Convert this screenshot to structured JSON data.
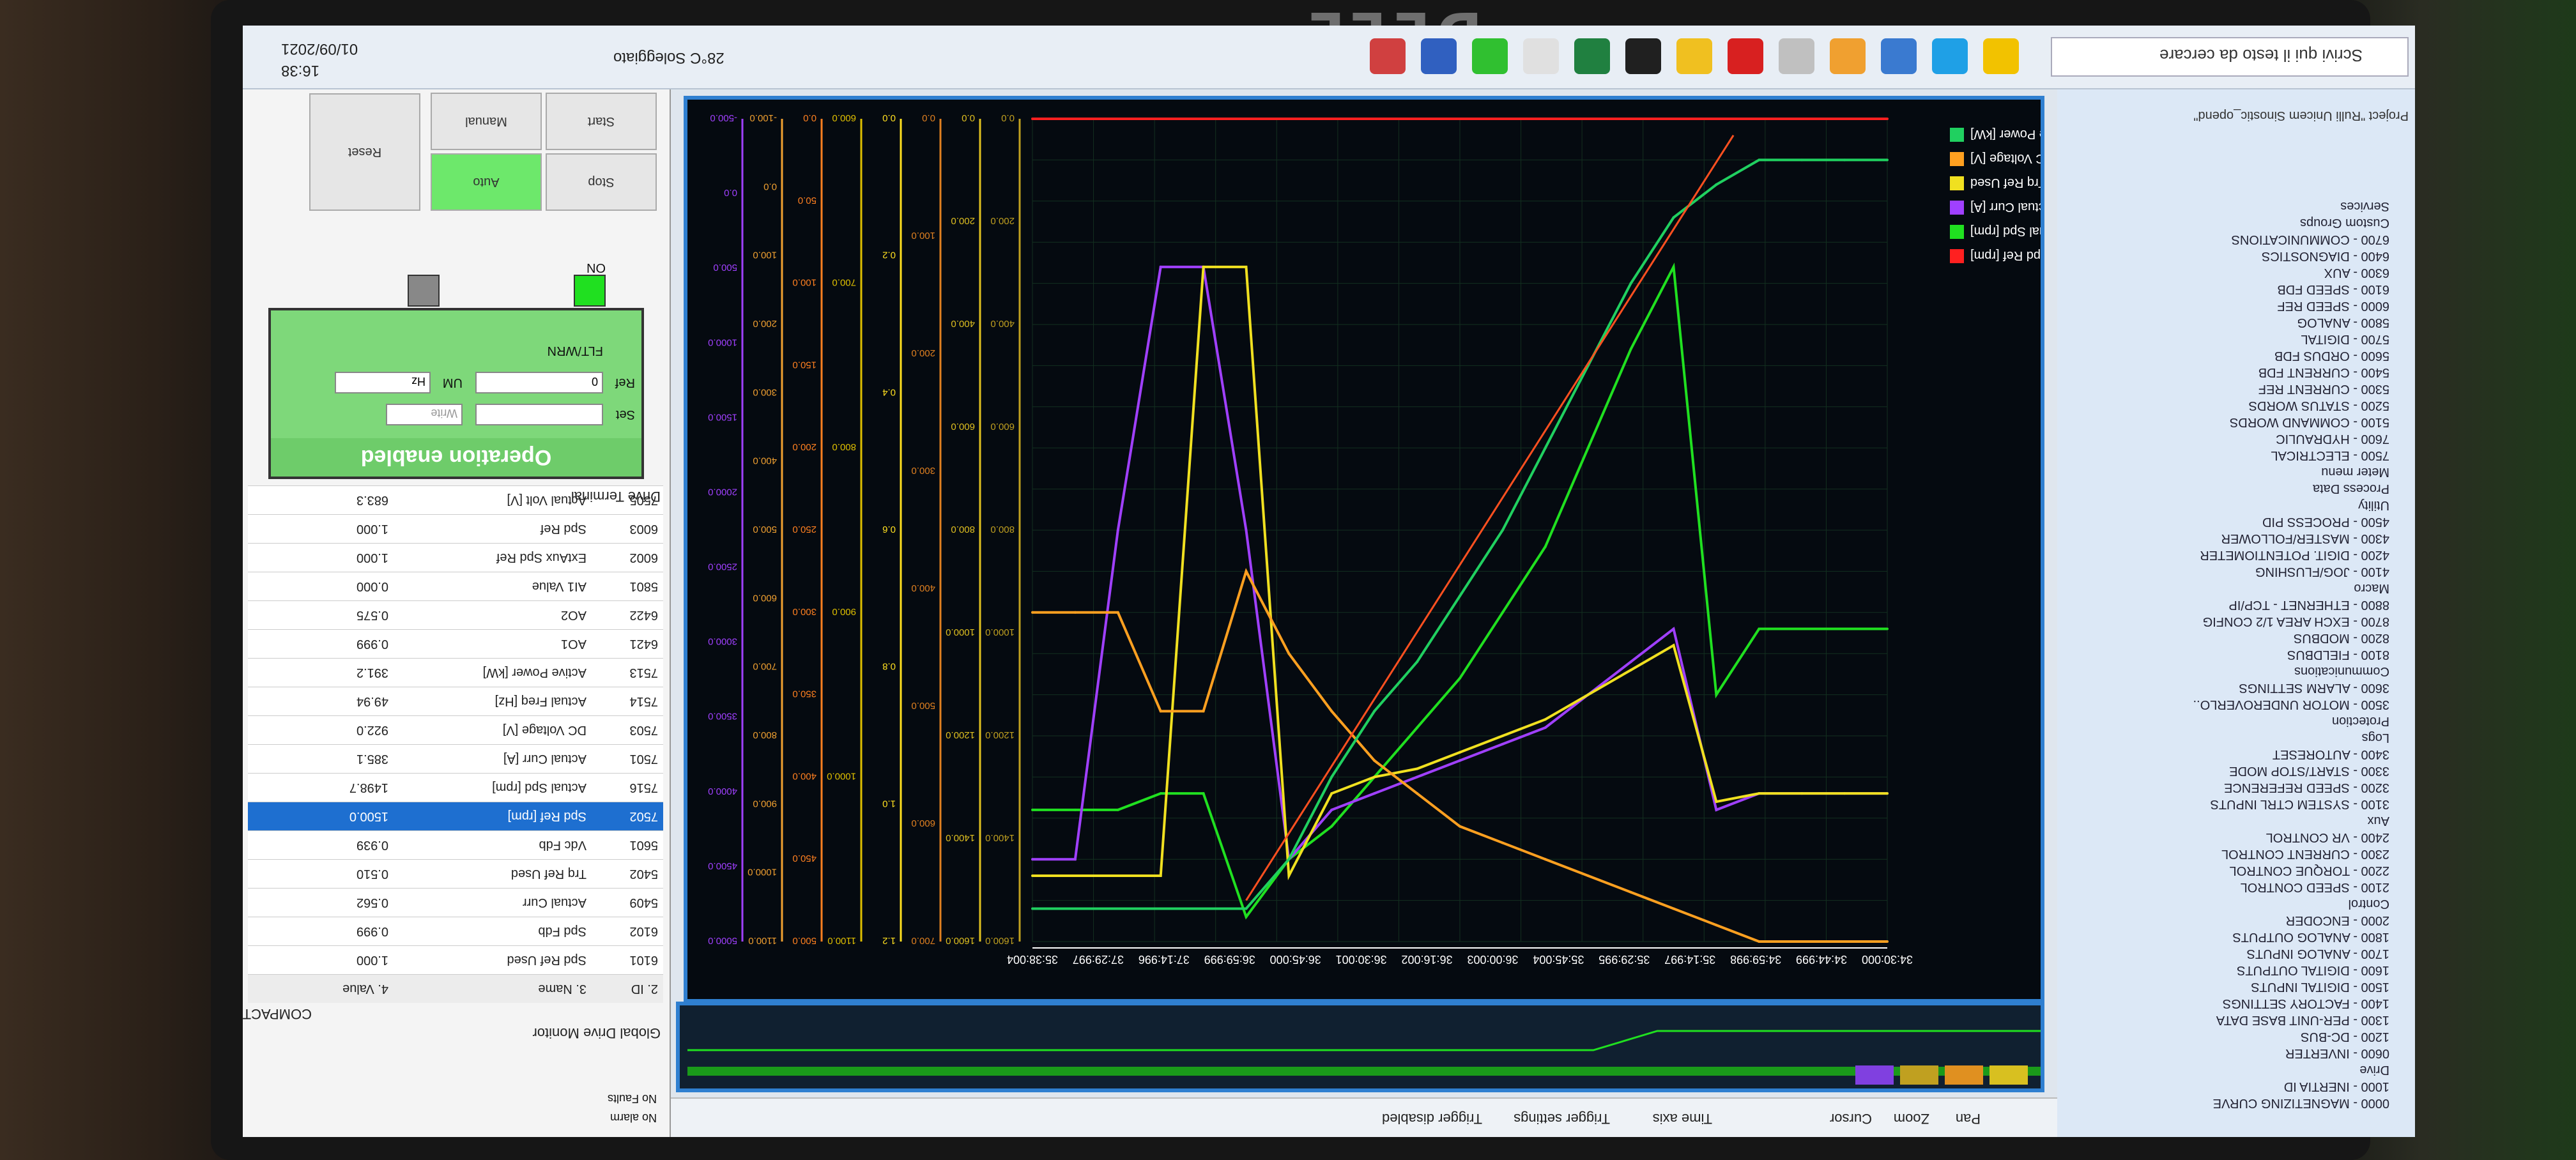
{
  "bezel_brand": "DELL",
  "taskbar": {
    "search_placeholder": "Scrivi qui il testo da cercare",
    "weather": "28°C Soleggiato",
    "time": "16:38",
    "date": "01/09/2021"
  },
  "project": {
    "title": "Project \"Rulli Unicem Sinostic_opend\"",
    "tree": [
      "0000 - MAGNETIZING CURVE",
      "1000 - INERTIA ID",
      "Drive",
      "0600 - INVERTER",
      "1200 - DC-BUS",
      "1300 - PER-UNIT BASE DATA",
      "1400 - FACTORY SETTINGS",
      "1500 - DIGITAL INPUTS",
      "1600 - DIGITAL OUTPUTS",
      "1700 - ANALOG INPUTS",
      "1800 - ANALOG OUTPUTS",
      "2000 - ENCODER",
      "Control",
      "2100 - SPEED CONTROL",
      "2200 - TORQUE CONTROL",
      "2300 - CURRENT CONTROL",
      "2400 - VR CONTROL",
      "Aux",
      "3100 - SYSTEM CTRL INPUTS",
      "3200 - SPEED REFERENCE",
      "3300 - START/STOP MODE",
      "3400 - AUTORESET",
      "Logs",
      "Protection",
      "3500 - MOTOR UNDEROVERLO..",
      "3600 - ALARM SETTINGS",
      "Communications",
      "8100 - FIELDBUS",
      "8200 - MODBUS",
      "8700 - EXCH AREA 1/2 CONFIG",
      "8800 - ETHERNET - TCP/IP",
      "Macro",
      "4100 - JOG/FLUSHING",
      "4200 - DIGIT. POTENTIOMETER",
      "4300 - MASTER/FOLLOWER",
      "4500 - PROCESS PID",
      "Utility",
      "Process Data",
      "Meter menu",
      "7500 - ELECTRICAL",
      "7600 - HYDRAULIC",
      "5100 - COMMAND WORDS",
      "5200 - STATUS WORDS",
      "5300 - CURRENT REF",
      "5400 - CURRENT FDB",
      "5600 - ORDUS FDB",
      "5700 - DIGITAL",
      "5800 - ANALOG",
      "6000 - SPEED REF",
      "6100 - SPEED FDB",
      "6300 - AUX",
      "6400 - DIAGNOSTICS",
      "6700 - COMMUNICATIONS",
      "Custom Groups",
      "Services"
    ]
  },
  "plot_toolbar": {
    "pan": "Pan",
    "zoom": "Zoom",
    "cursor": "Cursor",
    "time_axis": "Time axis",
    "trigger_settings": "Trigger settings",
    "trigger_status": "Trigger disabled",
    "colors": {
      "frame": "#2f7fd0",
      "plot_bg": "#050a10"
    }
  },
  "chart_data": {
    "type": "line",
    "x_ticks": [
      "35:38:004",
      "37:29:997",
      "37:14:996",
      "36:59:999",
      "36:45:000",
      "36:30:001",
      "36:16:002",
      "36:00:003",
      "35:45:004",
      "35:29:995",
      "35:14:997",
      "34:59:998",
      "34:44:999",
      "34:30:000"
    ],
    "x": [
      0,
      1,
      2,
      3,
      4,
      5,
      6,
      7,
      8,
      9,
      10,
      11,
      12,
      13,
      14,
      15,
      16,
      17,
      18,
      19,
      20
    ],
    "series": [
      {
        "name": "Spd Ref [rpm]",
        "color": "#ff2020",
        "values": [
          0,
          0,
          0,
          0,
          0,
          0,
          0,
          0,
          0,
          0,
          0,
          0,
          0,
          0,
          0,
          0,
          0,
          0,
          0,
          0,
          0
        ]
      },
      {
        "name": "Actual Spd [rpm]",
        "color": "#20e020",
        "values": [
          0.62,
          0.62,
          0.62,
          0.62,
          0.7,
          0.18,
          0.28,
          0.4,
          0.52,
          0.6,
          0.68,
          0.74,
          0.8,
          0.86,
          0.9,
          0.97,
          0.82,
          0.82,
          0.84,
          0.84,
          0.84
        ]
      },
      {
        "name": "Actual Curr [A]",
        "color": "#a040ff",
        "values": [
          0.82,
          0.82,
          0.82,
          0.82,
          0.84,
          0.62,
          0.66,
          0.7,
          0.74,
          0.76,
          0.78,
          0.8,
          0.82,
          0.84,
          0.9,
          0.5,
          0.18,
          0.18,
          0.5,
          0.9,
          0.9
        ]
      },
      {
        "name": "Trq Ref Used",
        "color": "#f0e020",
        "values": [
          0.82,
          0.82,
          0.82,
          0.82,
          0.83,
          0.64,
          0.67,
          0.7,
          0.73,
          0.75,
          0.77,
          0.79,
          0.8,
          0.82,
          0.92,
          0.18,
          0.18,
          0.92,
          0.92,
          0.92,
          0.92
        ]
      },
      {
        "name": "DC Voltage [V]",
        "color": "#ffa020",
        "values": [
          1.0,
          1.0,
          1.0,
          1.0,
          0.98,
          0.96,
          0.94,
          0.92,
          0.9,
          0.88,
          0.86,
          0.82,
          0.78,
          0.72,
          0.65,
          0.55,
          0.72,
          0.72,
          0.6,
          0.6,
          0.6
        ]
      },
      {
        "name": "Active Power [kW]",
        "color": "#20d060",
        "values": [
          0.05,
          0.05,
          0.05,
          0.05,
          0.08,
          0.12,
          0.2,
          0.3,
          0.4,
          0.5,
          0.58,
          0.66,
          0.72,
          0.8,
          0.9,
          0.96,
          0.96,
          0.96,
          0.96,
          0.96,
          0.96
        ]
      }
    ],
    "axis_scales": [
      [
        "1600.0",
        "1400.0",
        "1200.0",
        "1000.0",
        "800.0",
        "600.0",
        "400.0",
        "200.0",
        "0.0"
      ],
      [
        "1600.0",
        "1400.0",
        "1200.0",
        "1000.0",
        "800.0",
        "600.0",
        "400.0",
        "200.0",
        "0.0"
      ],
      [
        "700.0",
        "600.0",
        "500.0",
        "400.0",
        "300.0",
        "200.0",
        "100.0",
        "0.0"
      ],
      [
        "1.2",
        "1.0",
        "0.8",
        "0.6",
        "0.4",
        "0.2",
        "0.0"
      ],
      [
        "1100.0",
        "1000.0",
        "900.0",
        "800.0",
        "700.0",
        "600.0"
      ],
      [
        "500.0",
        "450.0",
        "400.0",
        "350.0",
        "300.0",
        "250.0",
        "200.0",
        "150.0",
        "100.0",
        "50.0",
        "0.0"
      ],
      [
        "1100.0",
        "1000.0",
        "900.0",
        "800.0",
        "700.0",
        "600.0",
        "500.0",
        "400.0",
        "300.0",
        "200.0",
        "100.0",
        "0.0",
        "-100.0"
      ],
      [
        "5000.0",
        "4500.0",
        "4000.0",
        "3500.0",
        "3000.0",
        "2500.0",
        "2000.0",
        "1500.0",
        "1000.0",
        "500.0",
        "0.0",
        "-500.0"
      ]
    ],
    "legend_position": "bottom-left",
    "grid": true
  },
  "monitor": {
    "title": "Global Drive Monitor",
    "mode": "COMPACT",
    "headers": [
      "2. ID",
      "3. Name",
      "4. Value"
    ],
    "rows": [
      {
        "id": "6101",
        "name": "Spd Ref Used",
        "value": "1.000"
      },
      {
        "id": "6102",
        "name": "Spd Fdb",
        "value": "0.999"
      },
      {
        "id": "5409",
        "name": "Actual Curr",
        "value": "0.562"
      },
      {
        "id": "5402",
        "name": "Trq Ref Used",
        "value": "0.510"
      },
      {
        "id": "5601",
        "name": "Vdc Fdb",
        "value": "0.939"
      },
      {
        "id": "7502",
        "name": "Spd Ref [rpm]",
        "value": "1500.0",
        "selected": true
      },
      {
        "id": "7516",
        "name": "Actual Spd [rpm]",
        "value": "1498.7"
      },
      {
        "id": "7501",
        "name": "Actual Curr [A]",
        "value": "385.1"
      },
      {
        "id": "7503",
        "name": "DC Voltage [V]",
        "value": "922.0"
      },
      {
        "id": "7514",
        "name": "Actual Freq [Hz]",
        "value": "49.94"
      },
      {
        "id": "7513",
        "name": "Active Power [kW]",
        "value": "391.2"
      },
      {
        "id": "6421",
        "name": "AO1",
        "value": "0.999"
      },
      {
        "id": "6422",
        "name": "AO2",
        "value": "0.575"
      },
      {
        "id": "5801",
        "name": "AI1 Value",
        "value": "0.000"
      },
      {
        "id": "6002",
        "name": "ExtAux Spd Ref",
        "value": "1.000"
      },
      {
        "id": "6003",
        "name": "Spd Ref",
        "value": "1.000"
      },
      {
        "id": "7505",
        "name": "Actual Volt [V]",
        "value": "683.3"
      }
    ]
  },
  "drive_terminal": {
    "title": "Drive Terminal",
    "status": "Operation enabled",
    "ref_label": "Ref",
    "ref_value": "0",
    "set_label": "Set",
    "um_label": "UM",
    "um_value": "Hz",
    "write_label": "Write",
    "on_label": "ON",
    "flt_label": "FLT/WRN",
    "buttons": {
      "start": "Start",
      "stop": "Stop",
      "manual": "Manual",
      "auto": "Auto",
      "reset": "Reset"
    }
  },
  "status_bar": {
    "alarm": "No alarm",
    "faults": "No Faults"
  }
}
